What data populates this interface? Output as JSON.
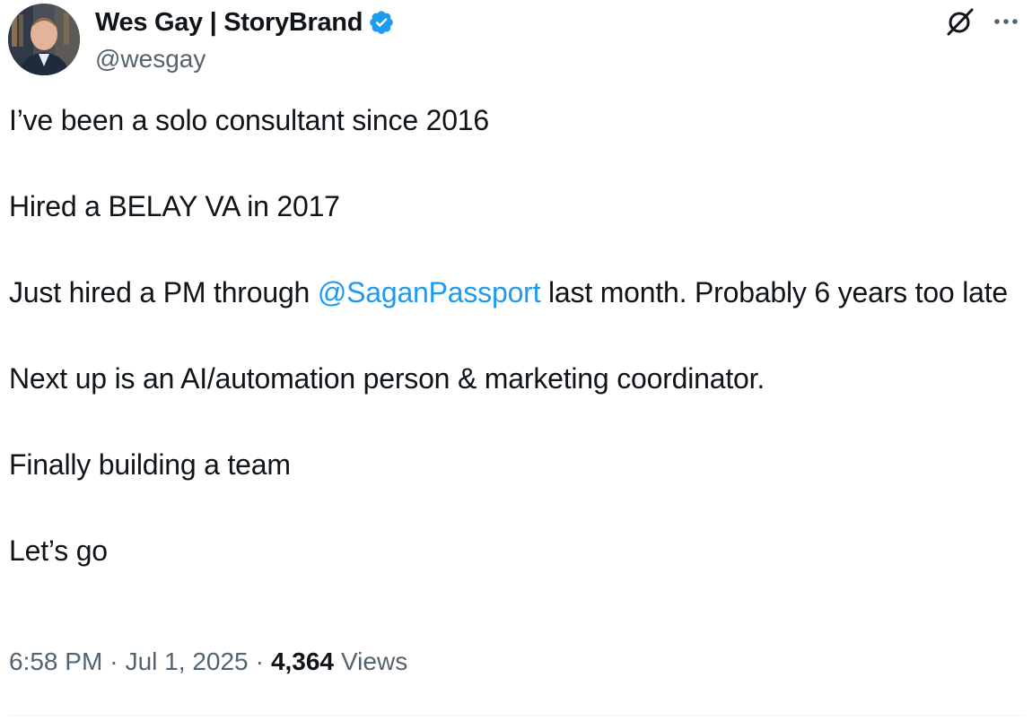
{
  "author": {
    "display_name": "Wes Gay | StoryBrand",
    "handle": "@wesgay",
    "verified": true,
    "verified_color": "#1d9bf0"
  },
  "header_icons": {
    "grok": "grok-icon",
    "more": "more-icon"
  },
  "tweet": {
    "line1": "I’ve been a solo consultant since 2016",
    "line2": "Hired a BELAY VA in 2017",
    "line3_before": "Just hired a PM through ",
    "line3_mention": "@SaganPassport",
    "line3_after": " last month. Probably 6 years too late",
    "line4": "Next up is an AI/automation person & marketing coordinator.",
    "line5": "Finally building a team",
    "line6": "Let’s go"
  },
  "meta": {
    "time": "6:58 PM",
    "separator": "·",
    "date": "Jul 1, 2025",
    "views_count": "4,364",
    "views_label": "Views"
  },
  "colors": {
    "text": "#0f1419",
    "secondary": "#536471",
    "link": "#1d9bf0"
  }
}
